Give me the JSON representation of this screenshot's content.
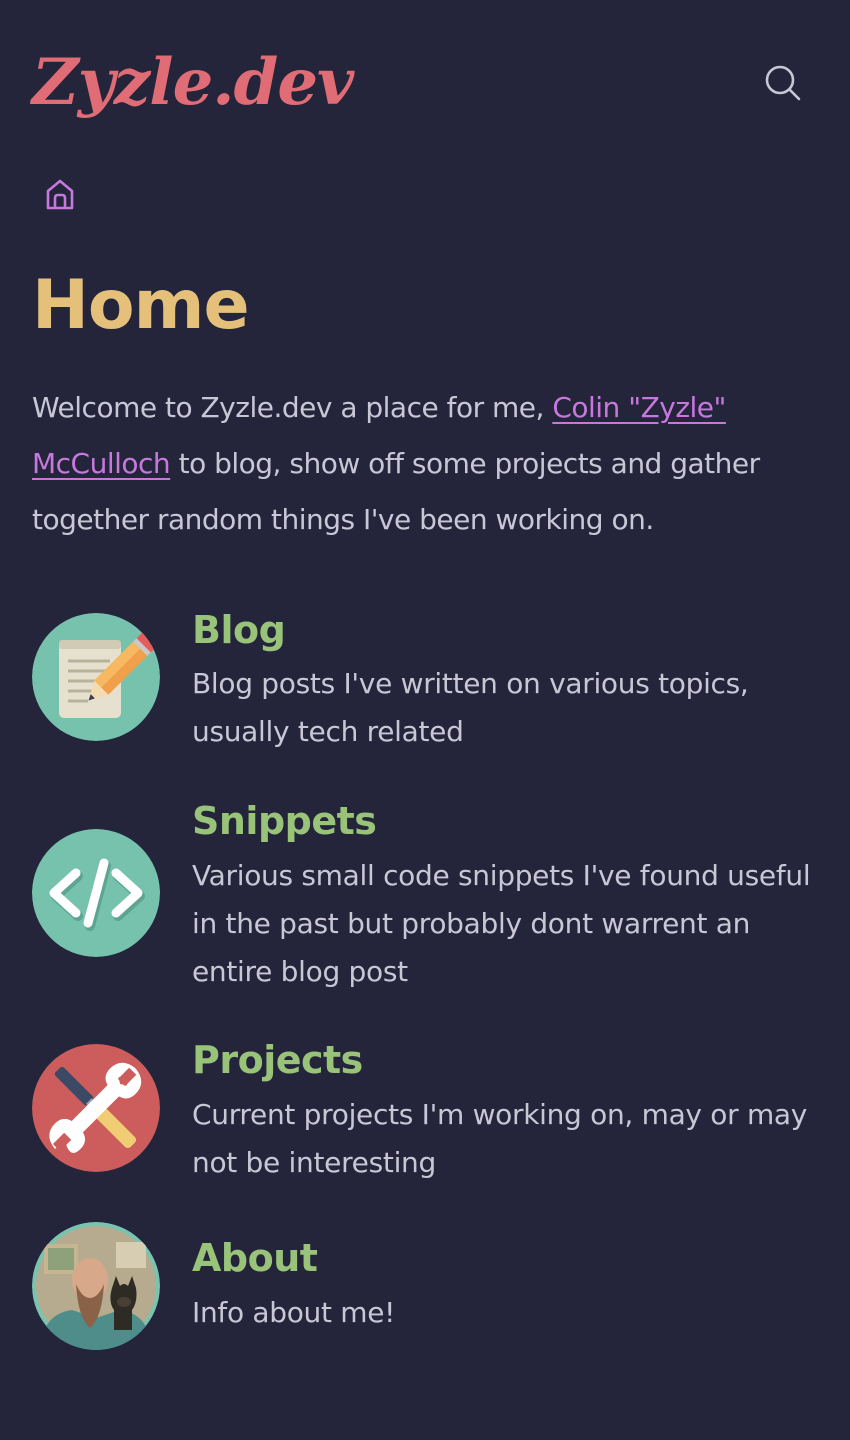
{
  "site": {
    "logo": "Zyzle.dev"
  },
  "header": {
    "search_icon": "search-icon"
  },
  "breadcrumb": {
    "home_icon": "home-icon"
  },
  "page": {
    "title": "Home",
    "intro_before": "Welcome to Zyzle.dev a place for me, ",
    "intro_link": "Colin \"Zyzle\" McCulloch",
    "intro_after": " to blog, show off some projects and gather together random things I've been working on."
  },
  "sections": [
    {
      "title": "Blog",
      "description": "Blog posts I've written on various topics, usually tech related",
      "icon": "notepad-pencil-icon"
    },
    {
      "title": "Snippets",
      "description": "Various small code snippets I've found useful in the past but probably dont warrent an entire blog post",
      "icon": "code-icon"
    },
    {
      "title": "Projects",
      "description": "Current projects I'm working on, may or may not be interesting",
      "icon": "tools-icon"
    },
    {
      "title": "About",
      "description": "Info about me!",
      "icon": "avatar-photo"
    }
  ],
  "colors": {
    "background": "#24253b",
    "logo": "#e06c75",
    "heading": "#e5c07b",
    "section_title": "#98c379",
    "link": "#c678dd",
    "text": "#c9c7d6"
  }
}
